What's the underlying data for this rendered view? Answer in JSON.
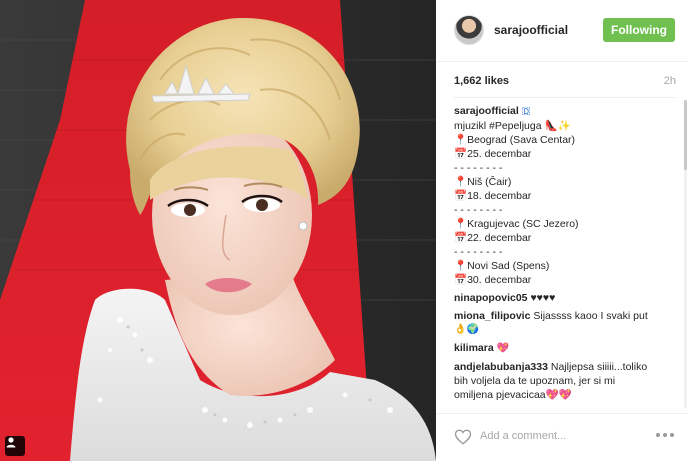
{
  "post": {
    "username": "sarajoofficial",
    "follow_label": "Following",
    "likes": "1,662 likes",
    "time_ago": "2h"
  },
  "caption": {
    "username": "sarajoofficial",
    "line1_suffix": "🇩",
    "line2": "mjuzikl #Pepeljuga 👠✨",
    "line3": "📍Beograd (Sava Centar)",
    "line4": "📅25. decembar",
    "sep1": "- - - - - - - -",
    "line5": "📍Niš (Čair)",
    "line6": "📅18. decembar",
    "sep2": "- - - - - - - -",
    "line7": "📍Kragujevac (SC Jezero)",
    "line8": "📅22. decembar",
    "sep3": "- - - - - - - -",
    "line9": "📍Novi Sad (Spens)",
    "line10": "📅30. decembar"
  },
  "comments": [
    {
      "user": "ninapopovic05",
      "text": "♥♥♥♥"
    },
    {
      "user": "miona_filipovic",
      "text": "Sijassss kaoo I svaki put",
      "text2": "👌🌍"
    },
    {
      "user": "kilimara",
      "text": "💖"
    },
    {
      "user": "andjelabubanja333",
      "text": "Najljepsa siiiii...toliko",
      "text2": "bih voljela da te upoznam, jer si mi",
      "text3": "omiljena pjevacicaa💖💖"
    }
  ],
  "footer": {
    "comment_placeholder": "Add a comment..."
  },
  "colors": {
    "follow_button": "#70c050",
    "carpet": "#d81e2a",
    "muted_text": "#a5a7aa"
  },
  "icons": {
    "heart": "heart-outline-icon",
    "more": "more-options-icon",
    "user_tag": "user-tag-icon"
  }
}
